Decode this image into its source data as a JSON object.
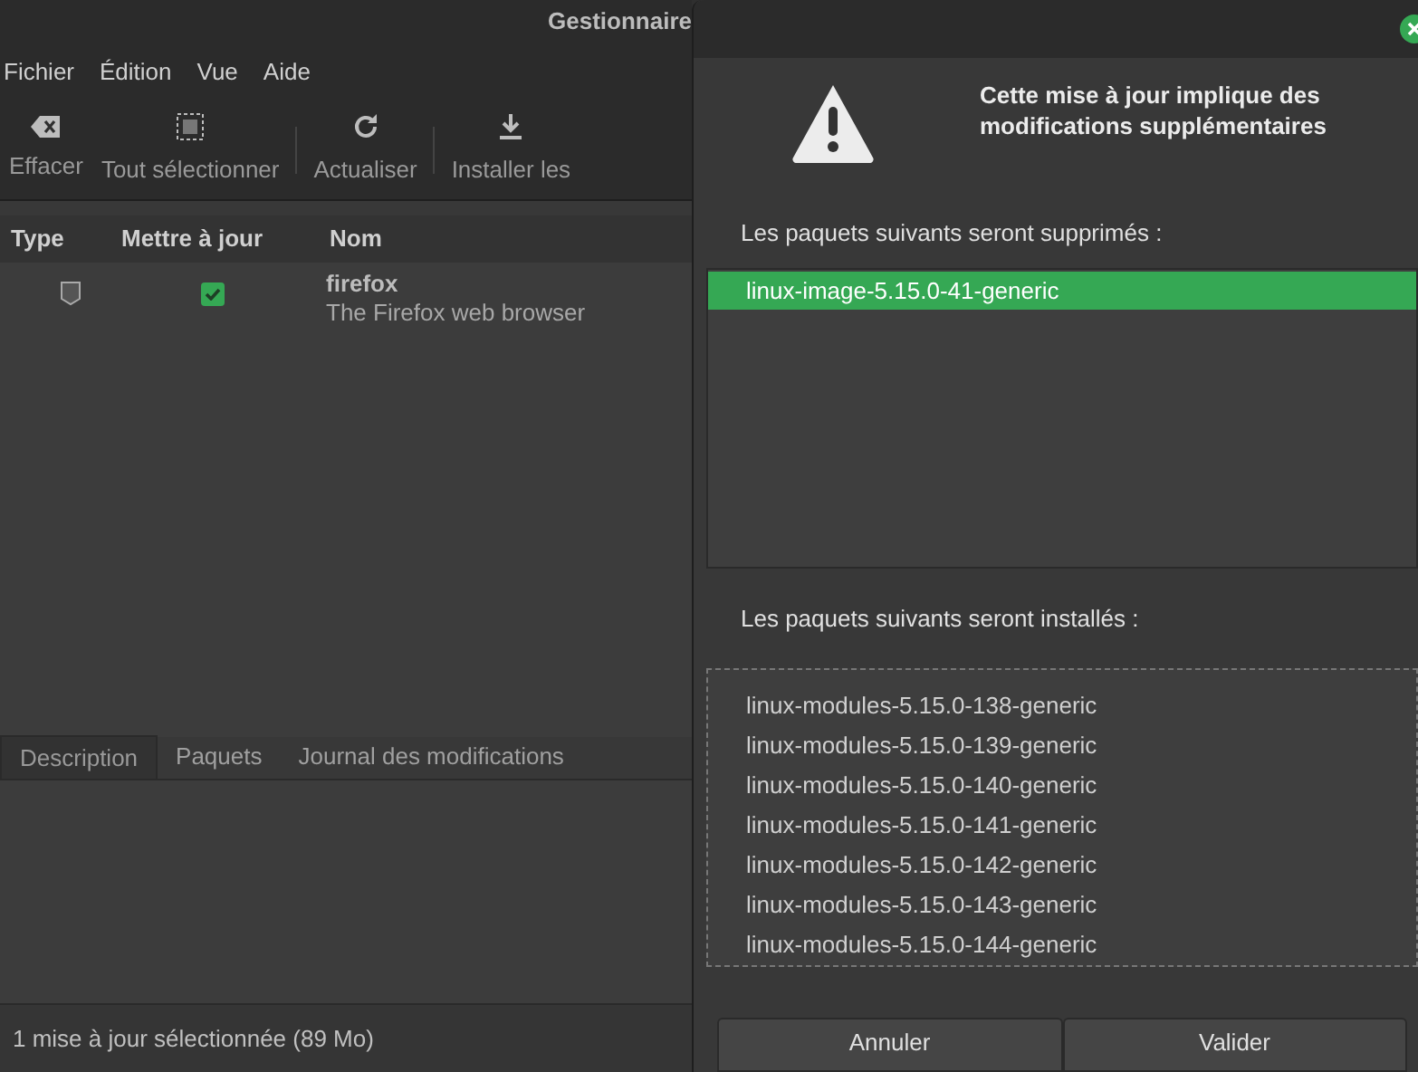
{
  "window": {
    "title": "Gestionnaire"
  },
  "menu": [
    "Fichier",
    "Édition",
    "Vue",
    "Aide"
  ],
  "toolbar": [
    {
      "label": "Effacer",
      "kind": "clear"
    },
    {
      "label": "Tout sélectionner",
      "kind": "select-all"
    },
    {
      "label": "Actualiser",
      "kind": "refresh",
      "separator_before": true
    },
    {
      "label": "Installer les",
      "kind": "install",
      "separator_before": true
    }
  ],
  "table": {
    "columns": [
      "Type",
      "Mettre à jour",
      "Nom"
    ],
    "rows": [
      {
        "name": "firefox",
        "description": "The Firefox web browser",
        "checked": true
      }
    ]
  },
  "tabs": [
    {
      "label": "Description",
      "selected": true
    },
    {
      "label": "Paquets",
      "selected": false
    },
    {
      "label": "Journal des modifications",
      "selected": false
    }
  ],
  "status_bar": "1 mise à jour sélectionnée (89 Mo)",
  "dialog": {
    "title": "Cette mise à jour implique des modifications supplémentaires",
    "removed_label": "Les paquets suivants seront supprimés :",
    "removed": [
      {
        "name": "linux-image-5.15.0-41-generic",
        "selected": true
      }
    ],
    "installed_label": "Les paquets suivants seront installés :",
    "installed": [
      {
        "name": "linux-modules-5.15.0-138-generic",
        "selected": false
      },
      {
        "name": "linux-modules-5.15.0-139-generic",
        "selected": false
      },
      {
        "name": "linux-modules-5.15.0-140-generic",
        "selected": false
      },
      {
        "name": "linux-modules-5.15.0-141-generic",
        "selected": false
      },
      {
        "name": "linux-modules-5.15.0-142-generic",
        "selected": false
      },
      {
        "name": "linux-modules-5.15.0-143-generic",
        "selected": false
      },
      {
        "name": "linux-modules-5.15.0-144-generic",
        "selected": false
      }
    ],
    "buttons": [
      "Annuler",
      "Valider"
    ]
  }
}
